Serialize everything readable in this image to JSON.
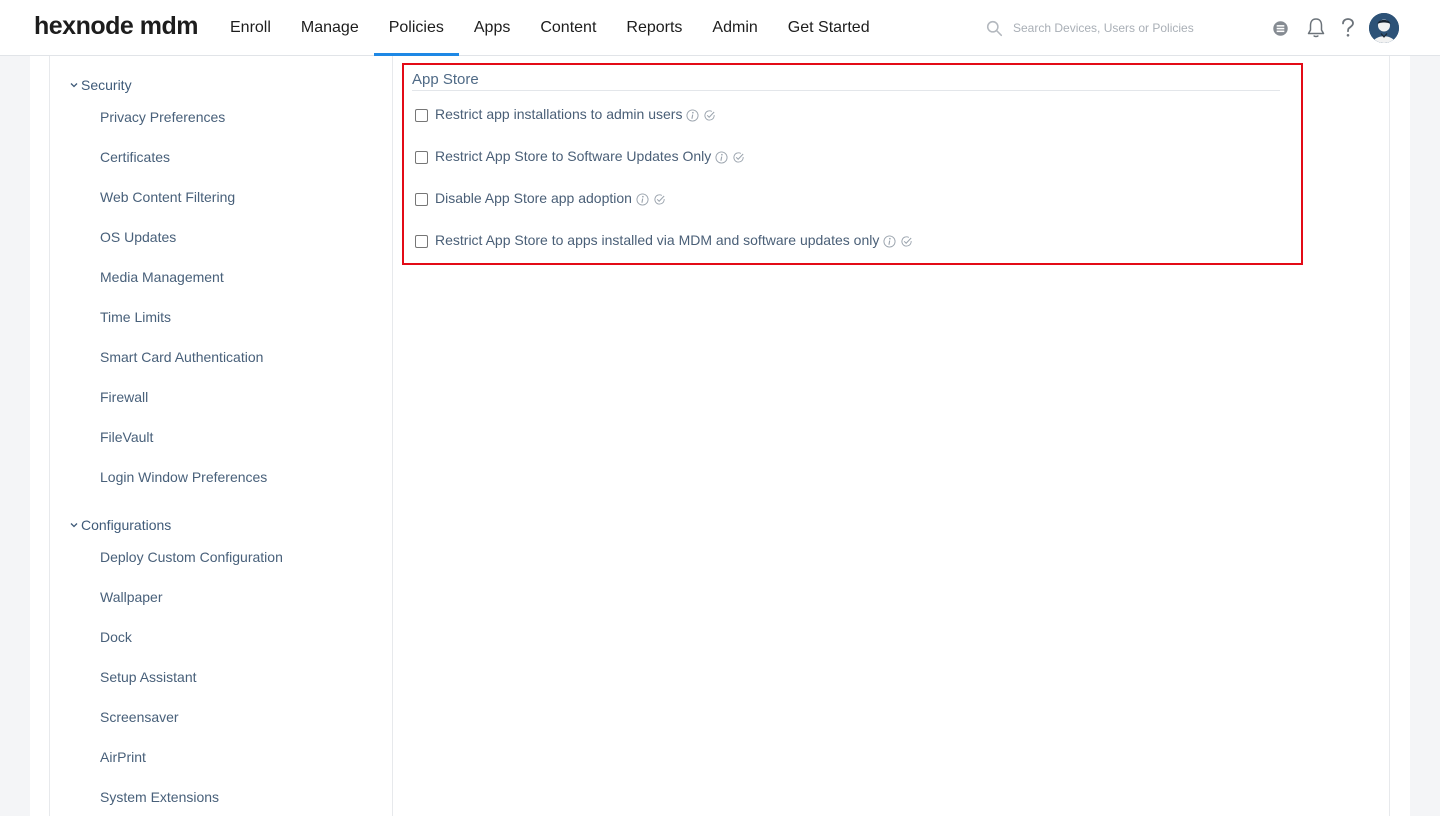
{
  "brand": {
    "name": "hexnode mdm"
  },
  "nav": {
    "items": [
      {
        "label": "Enroll"
      },
      {
        "label": "Manage"
      },
      {
        "label": "Policies",
        "active": true
      },
      {
        "label": "Apps"
      },
      {
        "label": "Content"
      },
      {
        "label": "Reports"
      },
      {
        "label": "Admin"
      },
      {
        "label": "Get Started"
      }
    ]
  },
  "search": {
    "placeholder": "Search Devices, Users or Policies",
    "icon": "search-icon"
  },
  "header_icons": [
    "help-center-icon",
    "bell-icon",
    "question-icon",
    "user-avatar"
  ],
  "accent_color": "#1e88e5",
  "highlight_color": "#e30b17",
  "sidebar": {
    "groups": [
      {
        "title": "Security",
        "items": [
          "Privacy Preferences",
          "Certificates",
          "Web Content Filtering",
          "OS Updates",
          "Media Management",
          "Time Limits",
          "Smart Card Authentication",
          "Firewall",
          "FileVault",
          "Login Window Preferences"
        ]
      },
      {
        "title": "Configurations",
        "items": [
          "Deploy Custom Configuration",
          "Wallpaper",
          "Dock",
          "Setup Assistant",
          "Screensaver",
          "AirPrint",
          "System Extensions"
        ]
      }
    ]
  },
  "app_store": {
    "title": "App Store",
    "options": [
      {
        "label": "Restrict app installations to admin users",
        "checked": false
      },
      {
        "label": "Restrict App Store to Software Updates Only",
        "checked": false
      },
      {
        "label": "Disable App Store app adoption",
        "checked": false
      },
      {
        "label": "Restrict App Store to apps installed via MDM and software updates only",
        "checked": false
      }
    ]
  }
}
